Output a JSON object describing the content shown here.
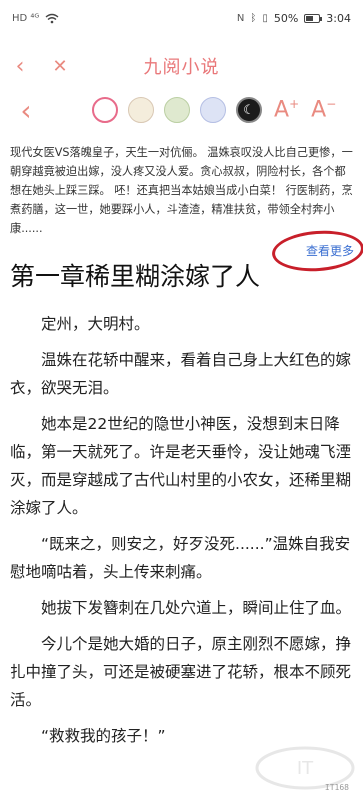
{
  "status_bar": {
    "left_icons": "HD ⁴ᴳ",
    "wifi_icon": "wifi-icon",
    "battery_percent": "50%",
    "time": "3:04"
  },
  "nav": {
    "back_glyph": "‹",
    "close_glyph": "✕",
    "title": "九阅小说"
  },
  "toolbar": {
    "back_glyph": "‹",
    "font_increase_label": "A",
    "font_increase_sup": "+",
    "font_decrease_label": "A",
    "font_decrease_sup": "−",
    "night_glyph": "☾",
    "theme_colors": [
      "#ffffff",
      "#f4eddc",
      "#dfe9cf",
      "#dde3f5",
      "#1b1b1b"
    ]
  },
  "intro": {
    "text": "现代女医VS落魄皇子，天生一对伉俪。 温姝哀叹没人比自己更惨，一朝穿越竟被迫出嫁，没人疼又没人爱。贪心叔叔，阴险村长，各个都想在她头上踩三踩。 呸！还真把当本姑娘当成小白菜！ 行医制药，烹煮药膳，这一世，她要踩小人，斗渣渣，精准扶贫，带领全村奔小康......",
    "more_label": "查看更多"
  },
  "chapter": {
    "title": "第一章稀里糊涂嫁了人",
    "paragraphs": [
      "定州，大明村。",
      "温姝在花轿中醒来，看着自己身上大红色的嫁衣，欲哭无泪。",
      "她本是22世纪的隐世小神医，没想到末日降临，第一天就死了。许是老天垂怜，没让她魂飞湮灭，而是穿越成了古代山村里的小农女，还稀里糊涂嫁了人。",
      "“既来之，则安之，好歹没死......”温姝自我安慰地嘀咕着，头上传来刺痛。",
      "她拔下发簪刺在几处穴道上，瞬间止住了血。",
      "今儿个是她大婚的日子，原主刚烈不愿嫁，挣扎中撞了头，可还是被硬塞进了花轿，根本不顾死活。",
      "“救救我的孩子！”"
    ]
  },
  "watermark": {
    "logo_text": "IT168"
  }
}
